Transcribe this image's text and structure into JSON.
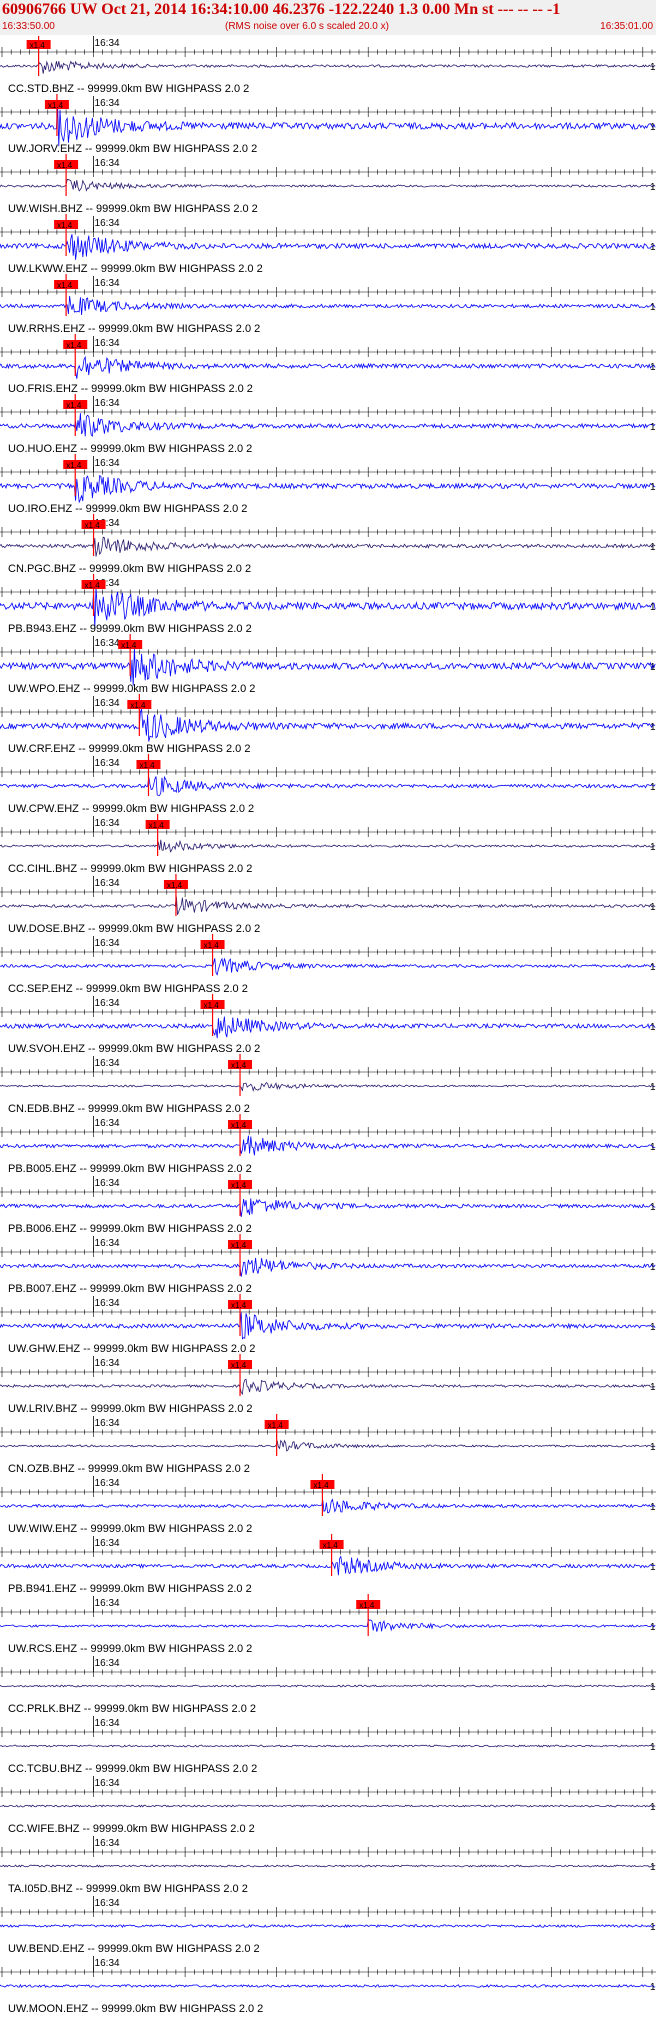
{
  "header": {
    "title": "60906766 UW Oct 21, 2014 16:34:10.00   46.2376 -122.2240  1.3 0.00 Mn st --- -- --   -1",
    "start_time": "16:33:50.00",
    "note": "(RMS noise over 6.0 s scaled 20.0 x)",
    "end_time": "16:35:01.00"
  },
  "colors": {
    "header_text": "#cc0000",
    "trace_blue": "#0000ff",
    "trace_dark": "#2a1a6e",
    "pick": "#ff0000",
    "axis": "#000000"
  },
  "chart_data": {
    "type": "line",
    "title": "60906766 UW Oct 21, 2014 16:34:10.00   46.2376 -122.2240  1.3 0.00 Mn st --- -- --   -1",
    "x_range": [
      "16:33:50.00",
      "16:35:01.00"
    ],
    "time_tick_label": "16:34",
    "pick_label": "x1.4",
    "edge_label": "1",
    "traces": [
      {
        "label": "CC.STD.BHZ -- 99999.0km BW  HIGHPASS  2.0  2",
        "pick": "16:33:54",
        "amp": 0.35,
        "dark": true
      },
      {
        "label": "UW.JORV.EHZ -- 99999.0km BW  HIGHPASS  2.0  2",
        "pick": "16:33:56",
        "amp": 0.9,
        "dark": false
      },
      {
        "label": "UW.WISH.BHZ -- 99999.0km BW  HIGHPASS  2.0  2",
        "pick": "16:33:57",
        "amp": 0.3,
        "dark": true
      },
      {
        "label": "UW.LKWW.EHZ -- 99999.0km BW  HIGHPASS  2.0  2",
        "pick": "16:33:57",
        "amp": 0.7,
        "dark": false
      },
      {
        "label": "UW.RRHS.EHZ -- 99999.0km BW  HIGHPASS  2.0  2",
        "pick": "16:33:57",
        "amp": 0.5,
        "dark": false
      },
      {
        "label": "UO.FRIS.EHZ -- 99999.0km BW  HIGHPASS  2.0  2",
        "pick": "16:33:58",
        "amp": 0.6,
        "dark": false
      },
      {
        "label": "UO.HUO.EHZ -- 99999.0km BW  HIGHPASS  2.0  2",
        "pick": "16:33:58",
        "amp": 0.6,
        "dark": false
      },
      {
        "label": "UO.IRO.EHZ -- 99999.0km BW  HIGHPASS  2.0  2",
        "pick": "16:33:58",
        "amp": 0.7,
        "dark": false
      },
      {
        "label": "CN.PGC.BHZ -- 99999.0km BW  HIGHPASS  2.0  2",
        "pick": "16:34:00",
        "amp": 0.5,
        "dark": true
      },
      {
        "label": "PB.B943.EHZ -- 99999.0km BW  HIGHPASS  2.0  2",
        "pick": "16:34:00",
        "amp": 1.0,
        "dark": false
      },
      {
        "label": "UW.WPO.EHZ -- 99999.0km BW  HIGHPASS  2.0  2",
        "pick": "16:34:04",
        "amp": 0.9,
        "dark": false
      },
      {
        "label": "UW.CRF.EHZ -- 99999.0km BW  HIGHPASS  2.0  2",
        "pick": "16:34:05",
        "amp": 0.8,
        "dark": false
      },
      {
        "label": "UW.CPW.EHZ -- 99999.0km BW  HIGHPASS  2.0  2",
        "pick": "16:34:06",
        "amp": 0.5,
        "dark": false
      },
      {
        "label": "CC.CIHL.BHZ -- 99999.0km BW  HIGHPASS  2.0  2",
        "pick": "16:34:07",
        "amp": 0.3,
        "dark": true
      },
      {
        "label": "UW.DOSE.BHZ -- 99999.0km BW  HIGHPASS  2.0  2",
        "pick": "16:34:09",
        "amp": 0.4,
        "dark": true
      },
      {
        "label": "CC.SEP.EHZ -- 99999.0km BW  HIGHPASS  2.0  2",
        "pick": "16:34:13",
        "amp": 0.4,
        "dark": false
      },
      {
        "label": "UW.SVOH.EHZ -- 99999.0km BW  HIGHPASS  2.0  2",
        "pick": "16:34:13",
        "amp": 0.6,
        "dark": false
      },
      {
        "label": "CN.EDB.BHZ -- 99999.0km BW  HIGHPASS  2.0  2",
        "pick": "16:34:16",
        "amp": 0.25,
        "dark": true
      },
      {
        "label": "PB.B005.EHZ -- 99999.0km BW  HIGHPASS  2.0  2",
        "pick": "16:34:16",
        "amp": 0.5,
        "dark": false
      },
      {
        "label": "PB.B006.EHZ -- 99999.0km BW  HIGHPASS  2.0  2",
        "pick": "16:34:16",
        "amp": 0.5,
        "dark": false
      },
      {
        "label": "PB.B007.EHZ -- 99999.0km BW  HIGHPASS  2.0  2",
        "pick": "16:34:16",
        "amp": 0.5,
        "dark": false
      },
      {
        "label": "UW.GHW.EHZ -- 99999.0km BW  HIGHPASS  2.0  2",
        "pick": "16:34:16",
        "amp": 0.6,
        "dark": false
      },
      {
        "label": "UW.LRIV.BHZ -- 99999.0km BW  HIGHPASS  2.0  2",
        "pick": "16:34:16",
        "amp": 0.35,
        "dark": true
      },
      {
        "label": "CN.OZB.BHZ -- 99999.0km BW  HIGHPASS  2.0  2",
        "pick": "16:34:20",
        "amp": 0.25,
        "dark": true
      },
      {
        "label": "UW.WIW.EHZ -- 99999.0km BW  HIGHPASS  2.0  2",
        "pick": "16:34:25",
        "amp": 0.4,
        "dark": false
      },
      {
        "label": "PB.B941.EHZ -- 99999.0km BW  HIGHPASS  2.0  2",
        "pick": "16:34:26",
        "amp": 0.5,
        "dark": false
      },
      {
        "label": "UW.RCS.EHZ -- 99999.0km BW  HIGHPASS  2.0  2",
        "pick": "16:34:30",
        "amp": 0.3,
        "dark": false
      },
      {
        "label": "CC.PRLK.BHZ -- 99999.0km BW  HIGHPASS  2.0  2",
        "pick": "",
        "amp": 0.25,
        "dark": true
      },
      {
        "label": "CC.TCBU.BHZ -- 99999.0km BW  HIGHPASS  2.0  2",
        "pick": "",
        "amp": 0.25,
        "dark": true
      },
      {
        "label": "CC.WIFE.BHZ -- 99999.0km BW  HIGHPASS  2.0  2",
        "pick": "",
        "amp": 0.25,
        "dark": true
      },
      {
        "label": "TA.I05D.BHZ -- 99999.0km BW  HIGHPASS  2.0  2",
        "pick": "",
        "amp": 0.25,
        "dark": true
      },
      {
        "label": "UW.BEND.EHZ -- 99999.0km BW  HIGHPASS  2.0  2",
        "pick": "",
        "amp": 0.35,
        "dark": false
      },
      {
        "label": "UW.MOON.EHZ -- 99999.0km BW  HIGHPASS  2.0  2",
        "pick": "",
        "amp": 0.35,
        "dark": false
      }
    ]
  }
}
